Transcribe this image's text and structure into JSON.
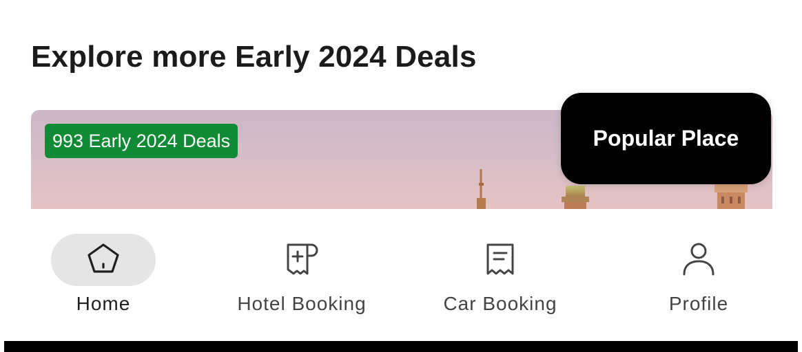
{
  "section": {
    "title": "Explore more Early 2024 Deals"
  },
  "card": {
    "deal_badge": "993 Early 2024 Deals",
    "overlay_label": "Popular Place"
  },
  "nav": {
    "items": [
      {
        "label": "Home",
        "icon": "home-icon",
        "active": true
      },
      {
        "label": "Hotel Booking",
        "icon": "hotel-booking-icon",
        "active": false
      },
      {
        "label": "Car Booking",
        "icon": "car-booking-icon",
        "active": false
      },
      {
        "label": "Profile",
        "icon": "profile-icon",
        "active": false
      }
    ]
  },
  "colors": {
    "badge_green": "#118a35",
    "active_pill": "#e5e5e6",
    "text_dark": "#1b1b1b"
  }
}
